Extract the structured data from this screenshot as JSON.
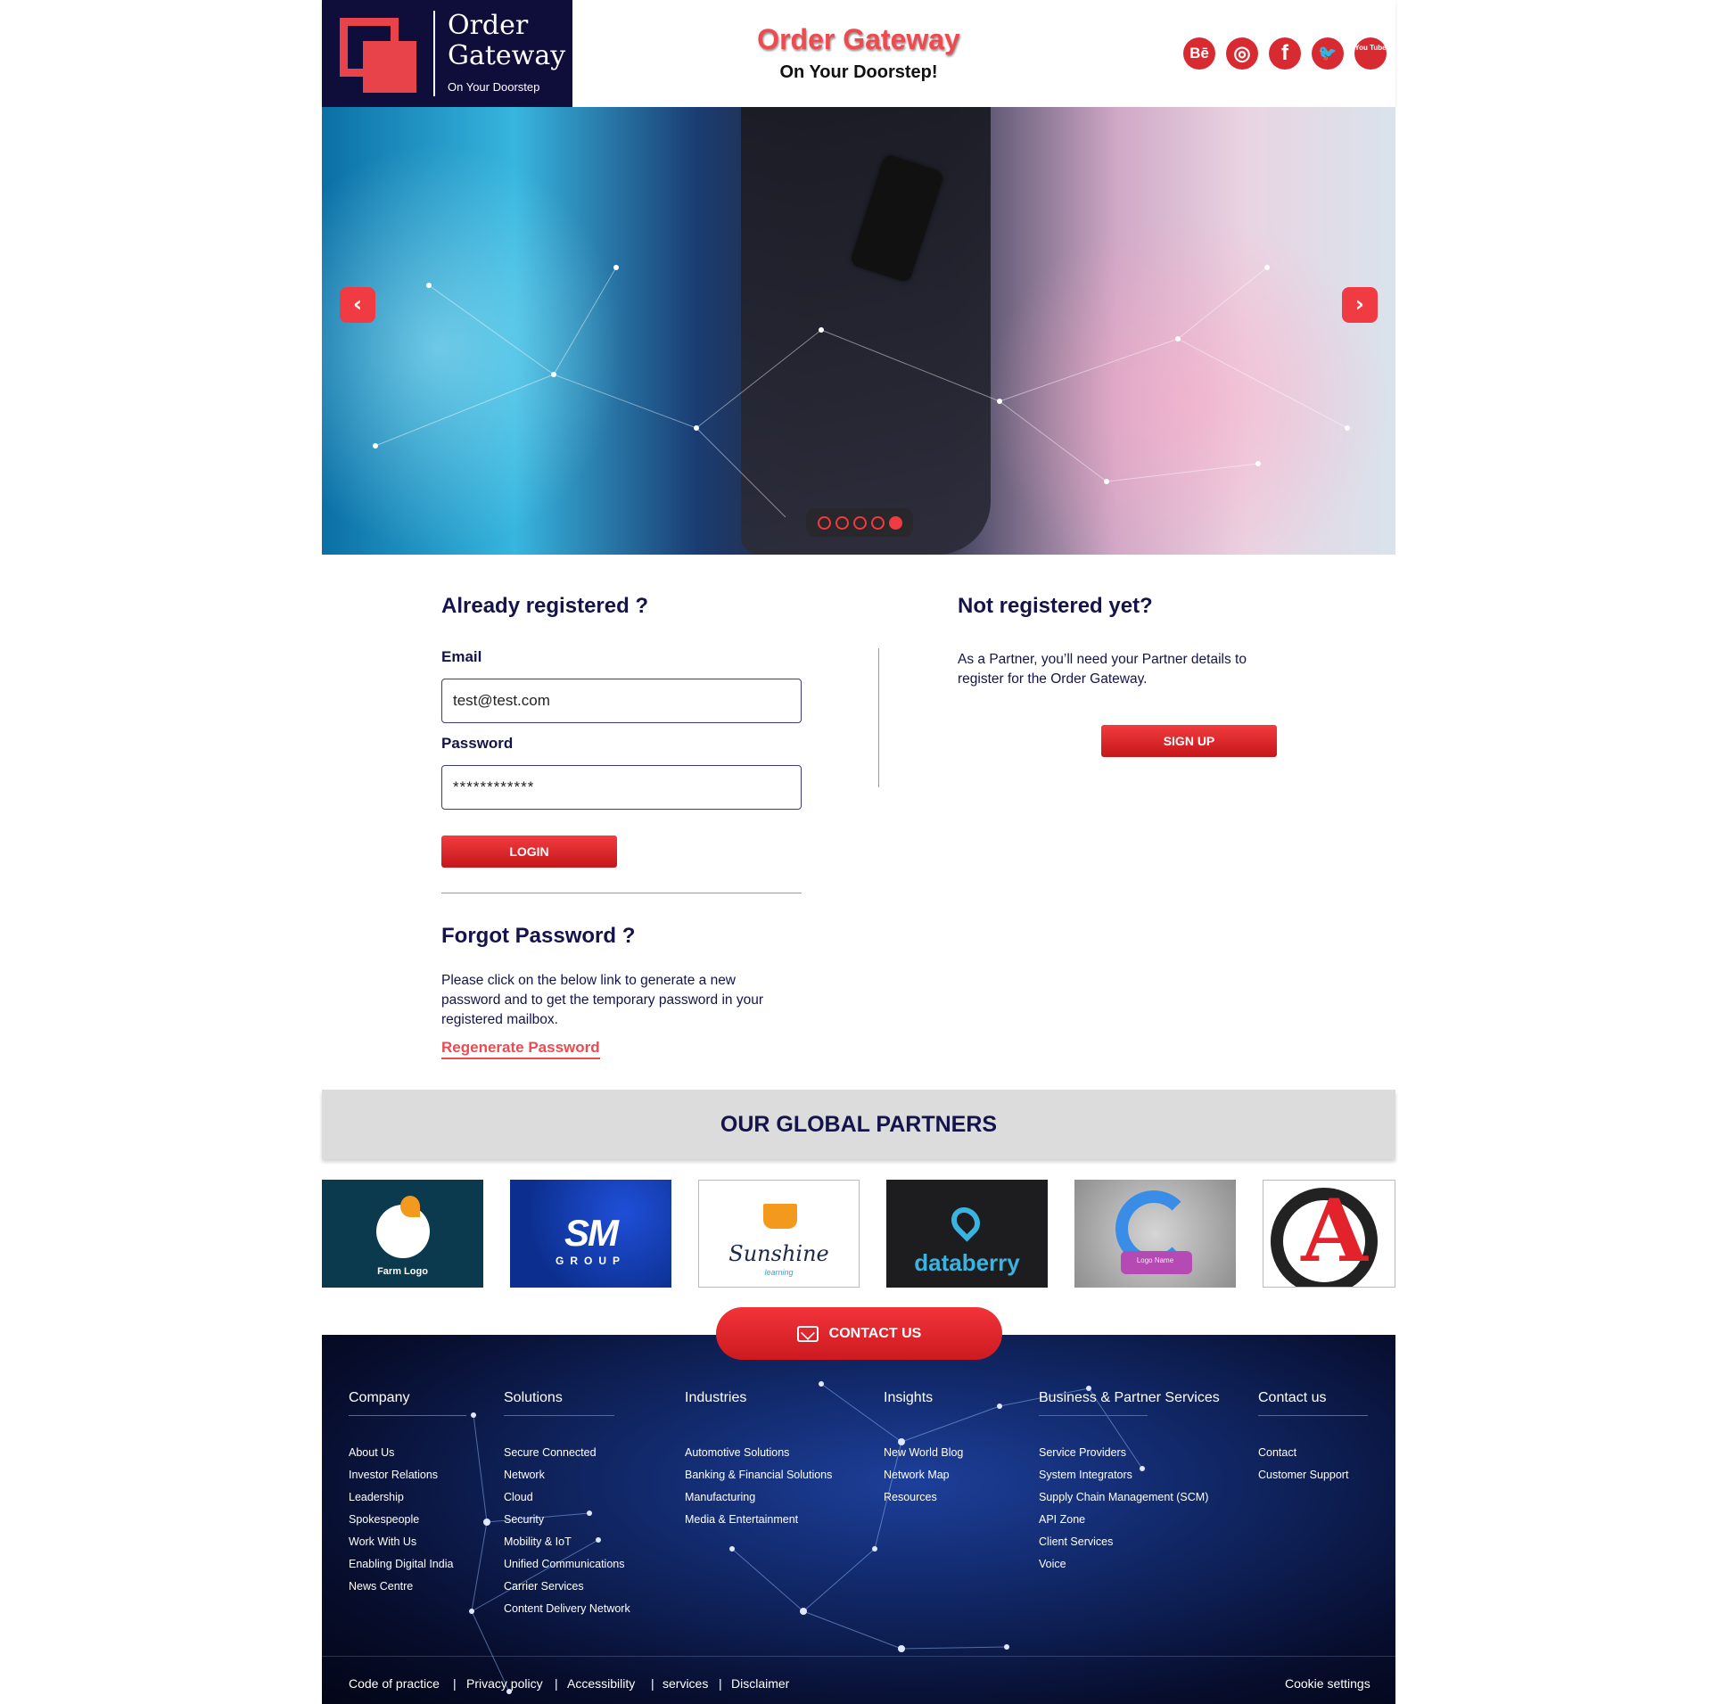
{
  "logo": {
    "line1": "Order",
    "line2": "Gateway",
    "tagline": "On Your Doorstep"
  },
  "header": {
    "title": "Order Gateway",
    "subtitle": "On Your Doorstep!"
  },
  "social": [
    {
      "name": "behance-icon",
      "glyph": "Bē"
    },
    {
      "name": "dribbble-icon",
      "glyph": "◎"
    },
    {
      "name": "facebook-icon",
      "glyph": "f"
    },
    {
      "name": "twitter-icon",
      "glyph": "🐦"
    },
    {
      "name": "youtube-icon",
      "glyph": "You Tube"
    }
  ],
  "carousel": {
    "prev": "‹",
    "next": "›",
    "slides": 5,
    "active_index": 4
  },
  "login": {
    "heading": "Already registered ?",
    "email_label": "Email",
    "email_value": "test@test.com",
    "password_label": "Password",
    "password_value": "************",
    "button": "LOGIN"
  },
  "forgot": {
    "heading": "Forgot Password ?",
    "text_line1": "Please click on the below link to generate a new",
    "text_line2": "password and to get the temporary password in your",
    "text_line3": "registered mailbox.",
    "link": "Regenerate Password"
  },
  "register": {
    "heading": "Not registered yet?",
    "text_line1": "As a Partner, you’ll need your Partner details to",
    "text_line2": "register for the Order Gateway.",
    "button": "SIGN UP"
  },
  "partners": {
    "title": "OUR GLOBAL PARTNERS",
    "logos": [
      {
        "text": "Farm Logo",
        "bg": "#0b3a4e"
      },
      {
        "text": "SM",
        "sub": "GROUP",
        "bg": "#0c2f8f"
      },
      {
        "text": "Sunshine",
        "sub": "learning",
        "bg": "#ffffff"
      },
      {
        "text": "databerry",
        "bg": "#1d1d1f"
      },
      {
        "text": "Logo Name",
        "bg": "#bfbfbf"
      },
      {
        "text": "A",
        "bg": "#ffffff"
      }
    ]
  },
  "contact_button": "CONTACT US",
  "footer": {
    "columns": [
      {
        "title": "Company",
        "items": [
          "About Us",
          "Investor Relations",
          "Leadership",
          "Spokespeople",
          "Work With Us",
          "Enabling Digital India",
          "News Centre"
        ]
      },
      {
        "title": "Solutions",
        "items": [
          "Secure Connected",
          "Network",
          "Cloud",
          "Security",
          "Mobility & IoT",
          "Unified Communications",
          "Carrier Services",
          "Content Delivery Network"
        ]
      },
      {
        "title": "Industries",
        "items": [
          "Automotive Solutions",
          "Banking & Financial Solutions",
          "Manufacturing",
          "Media & Entertainment"
        ]
      },
      {
        "title": "Insights",
        "items": [
          "New World Blog",
          "Network Map",
          "Resources"
        ]
      },
      {
        "title": "Business & Partner Services",
        "items": [
          "Service Providers",
          "System Integrators",
          "Supply Chain Management (SCM)",
          "API Zone",
          "Client Services",
          "Voice"
        ]
      },
      {
        "title": "Contact us",
        "items": [
          "Contact",
          "Customer Support"
        ]
      }
    ],
    "legal": [
      "Code of practice",
      "Privacy policy",
      "Accessibility",
      "services",
      "Disclaimer"
    ],
    "separator": "|",
    "cookie": "Cookie settings"
  },
  "colors": {
    "accent": "#ef3b41",
    "navy": "#14144a",
    "logo_bg": "#0f0d3a"
  }
}
